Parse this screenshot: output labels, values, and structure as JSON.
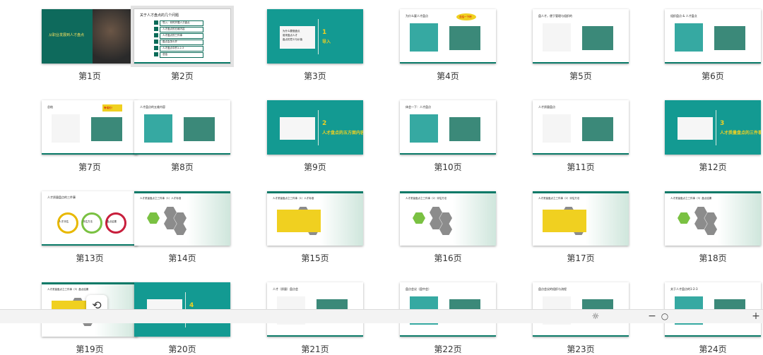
{
  "slides": [
    {
      "label": "第1页",
      "title": "从职业发展到人才盘点"
    },
    {
      "label": "第2页",
      "title": "关于人才盘点的几个问题",
      "items": [
        "导入：何时开展人才盘点",
        "人才盘点的五维内容",
        "人才盘点的三件事",
        "盘点会怎么开",
        "人才盘点中的1-2-3",
        "总结"
      ]
    },
    {
      "label": "第3页",
      "title": "导入",
      "num": "1",
      "items": [
        "为什么要做盘点",
        "谁来盘点人才",
        "盘点的意义与价值"
      ]
    },
    {
      "label": "第4页",
      "title": "为什么要人才盘点",
      "callout": "总结一下吧"
    },
    {
      "label": "第5页",
      "title": "盘人才，便于管理与组织的"
    },
    {
      "label": "第6页",
      "title": "组织盘点 & 人才盘点"
    },
    {
      "label": "第7页",
      "title": "总结",
      "callout": "警惕的！"
    },
    {
      "label": "第8页",
      "title": "人才盘点的五维内容"
    },
    {
      "label": "第9页",
      "title": "人才盘点的五方面内容",
      "num": "2"
    },
    {
      "label": "第10页",
      "title": "体会一下：人才盘点"
    },
    {
      "label": "第11页",
      "title": "人才质量盘点"
    },
    {
      "label": "第12页",
      "title": "人才质量盘点的三件事",
      "num": "3"
    },
    {
      "label": "第13页",
      "title": "人才质量盘点的三件事",
      "rings": [
        "人才评估",
        "评估方法",
        "盘点结果"
      ]
    },
    {
      "label": "第14页",
      "title": "人才质量盘点之三件事（1）人才标准"
    },
    {
      "label": "第15页",
      "title": "人才质量盘点之三件事（1）人才标准"
    },
    {
      "label": "第16页",
      "title": "人才质量盘点之三件事（2）评估方法"
    },
    {
      "label": "第17页",
      "title": "人才质量盘点之三件事（2）评估方法"
    },
    {
      "label": "第18页",
      "title": "人才质量盘点之三件事（3）盘点结果"
    },
    {
      "label": "第19页",
      "title": "人才质量盘点之三件事（3）盘点结果"
    },
    {
      "label": "第20页",
      "title": "盘点会怎么开",
      "num": "4"
    },
    {
      "label": "第21页",
      "title": "人才（质量）盘点会"
    },
    {
      "label": "第22页",
      "title": "盘点会议（盘中会）"
    },
    {
      "label": "第23页",
      "title": "盘点会议的组织与流程"
    },
    {
      "label": "第24页",
      "title": "关于人才盘点的1-2-3"
    }
  ],
  "selected_index": 1,
  "statusbar": {
    "minus": "−",
    "plus": "+",
    "zoom_icon": "zoom-out"
  },
  "fab_icon": "refresh",
  "colors": {
    "teal": "#139a92",
    "dark_green": "#0a6b58",
    "yellow": "#f0d020",
    "gray_hex": "#8c8c8c",
    "green": "#7ac142"
  }
}
